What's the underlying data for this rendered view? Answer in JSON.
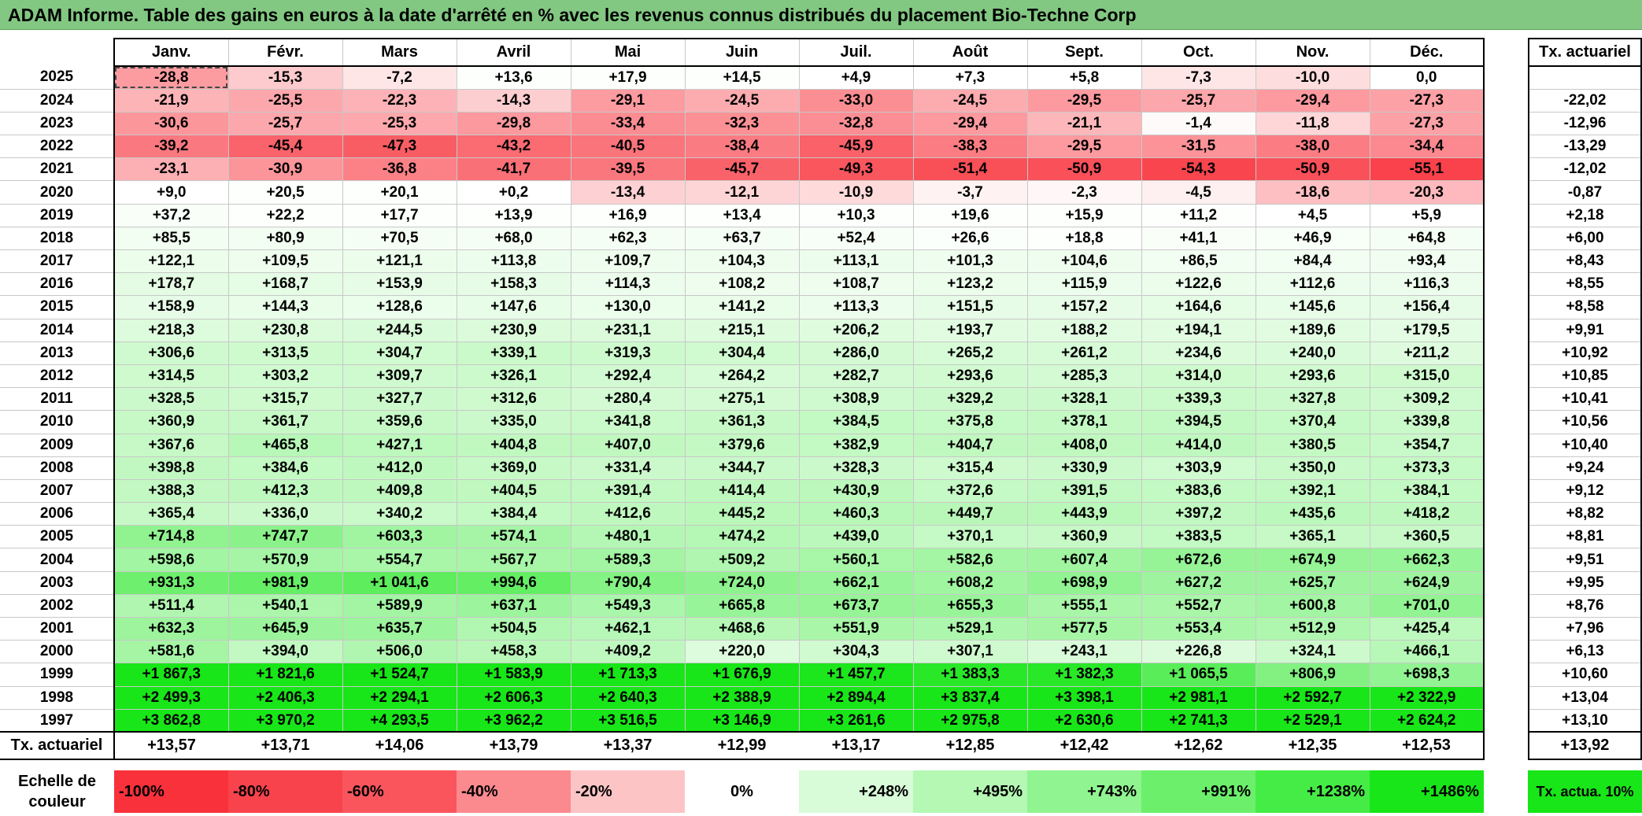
{
  "title": "ADAM Informe. Table des gains en euros à la date d'arrêté en % avec les revenus connus distribués du placement Bio-Techne Corp",
  "months": [
    "Janv.",
    "Févr.",
    "Mars",
    "Avril",
    "Mai",
    "Juin",
    "Juil.",
    "Août",
    "Sept.",
    "Oct.",
    "Nov.",
    "Déc."
  ],
  "tx_header": "Tx. actuariel",
  "rows": [
    {
      "year": "2025",
      "values": [
        "-28,8",
        "-15,3",
        "-7,2",
        "+13,6",
        "+17,9",
        "+14,5",
        "+4,9",
        "+7,3",
        "+5,8",
        "-7,3",
        "-10,0",
        "0,0"
      ],
      "tx": ""
    },
    {
      "year": "2024",
      "values": [
        "-21,9",
        "-25,5",
        "-22,3",
        "-14,3",
        "-29,1",
        "-24,5",
        "-33,0",
        "-24,5",
        "-29,5",
        "-25,7",
        "-29,4",
        "-27,3"
      ],
      "tx": "-22,02"
    },
    {
      "year": "2023",
      "values": [
        "-30,6",
        "-25,7",
        "-25,3",
        "-29,8",
        "-33,4",
        "-32,3",
        "-32,8",
        "-29,4",
        "-21,1",
        "-1,4",
        "-11,8",
        "-27,3"
      ],
      "tx": "-12,96"
    },
    {
      "year": "2022",
      "values": [
        "-39,2",
        "-45,4",
        "-47,3",
        "-43,2",
        "-40,5",
        "-38,4",
        "-45,9",
        "-38,3",
        "-29,5",
        "-31,5",
        "-38,0",
        "-34,4"
      ],
      "tx": "-13,29"
    },
    {
      "year": "2021",
      "values": [
        "-23,1",
        "-30,9",
        "-36,8",
        "-41,7",
        "-39,5",
        "-45,7",
        "-49,3",
        "-51,4",
        "-50,9",
        "-54,3",
        "-50,9",
        "-55,1"
      ],
      "tx": "-12,02"
    },
    {
      "year": "2020",
      "values": [
        "+9,0",
        "+20,5",
        "+20,1",
        "+0,2",
        "-13,4",
        "-12,1",
        "-10,9",
        "-3,7",
        "-2,3",
        "-4,5",
        "-18,6",
        "-20,3"
      ],
      "tx": "-0,87"
    },
    {
      "year": "2019",
      "values": [
        "+37,2",
        "+22,2",
        "+17,7",
        "+13,9",
        "+16,9",
        "+13,4",
        "+10,3",
        "+19,6",
        "+15,9",
        "+11,2",
        "+4,5",
        "+5,9"
      ],
      "tx": "+2,18"
    },
    {
      "year": "2018",
      "values": [
        "+85,5",
        "+80,9",
        "+70,5",
        "+68,0",
        "+62,3",
        "+63,7",
        "+52,4",
        "+26,6",
        "+18,8",
        "+41,1",
        "+46,9",
        "+64,8"
      ],
      "tx": "+6,00"
    },
    {
      "year": "2017",
      "values": [
        "+122,1",
        "+109,5",
        "+121,1",
        "+113,8",
        "+109,7",
        "+104,3",
        "+113,1",
        "+101,3",
        "+104,6",
        "+86,5",
        "+84,4",
        "+93,4"
      ],
      "tx": "+8,43"
    },
    {
      "year": "2016",
      "values": [
        "+178,7",
        "+168,7",
        "+153,9",
        "+158,3",
        "+114,3",
        "+108,2",
        "+108,7",
        "+123,2",
        "+115,9",
        "+122,6",
        "+112,6",
        "+116,3"
      ],
      "tx": "+8,55"
    },
    {
      "year": "2015",
      "values": [
        "+158,9",
        "+144,3",
        "+128,6",
        "+147,6",
        "+130,0",
        "+141,2",
        "+113,3",
        "+151,5",
        "+157,2",
        "+164,6",
        "+145,6",
        "+156,4"
      ],
      "tx": "+8,58"
    },
    {
      "year": "2014",
      "values": [
        "+218,3",
        "+230,8",
        "+244,5",
        "+230,9",
        "+231,1",
        "+215,1",
        "+206,2",
        "+193,7",
        "+188,2",
        "+194,1",
        "+189,6",
        "+179,5"
      ],
      "tx": "+9,91"
    },
    {
      "year": "2013",
      "values": [
        "+306,6",
        "+313,5",
        "+304,7",
        "+339,1",
        "+319,3",
        "+304,4",
        "+286,0",
        "+265,2",
        "+261,2",
        "+234,6",
        "+240,0",
        "+211,2"
      ],
      "tx": "+10,92"
    },
    {
      "year": "2012",
      "values": [
        "+314,5",
        "+303,2",
        "+309,7",
        "+326,1",
        "+292,4",
        "+264,2",
        "+282,7",
        "+293,6",
        "+285,3",
        "+314,0",
        "+293,6",
        "+315,0"
      ],
      "tx": "+10,85"
    },
    {
      "year": "2011",
      "values": [
        "+328,5",
        "+315,7",
        "+327,7",
        "+312,6",
        "+280,4",
        "+275,1",
        "+308,9",
        "+329,2",
        "+328,1",
        "+339,3",
        "+327,8",
        "+309,2"
      ],
      "tx": "+10,41"
    },
    {
      "year": "2010",
      "values": [
        "+360,9",
        "+361,7",
        "+359,6",
        "+335,0",
        "+341,8",
        "+361,3",
        "+384,5",
        "+375,8",
        "+378,1",
        "+394,5",
        "+370,4",
        "+339,8"
      ],
      "tx": "+10,56"
    },
    {
      "year": "2009",
      "values": [
        "+367,6",
        "+465,8",
        "+427,1",
        "+404,8",
        "+407,0",
        "+379,6",
        "+382,9",
        "+404,7",
        "+408,0",
        "+414,0",
        "+380,5",
        "+354,7"
      ],
      "tx": "+10,40"
    },
    {
      "year": "2008",
      "values": [
        "+398,8",
        "+384,6",
        "+412,0",
        "+369,0",
        "+331,4",
        "+344,7",
        "+328,3",
        "+315,4",
        "+330,9",
        "+303,9",
        "+350,0",
        "+373,3"
      ],
      "tx": "+9,24"
    },
    {
      "year": "2007",
      "values": [
        "+388,3",
        "+412,3",
        "+409,8",
        "+404,5",
        "+391,4",
        "+414,4",
        "+430,9",
        "+372,6",
        "+391,5",
        "+383,6",
        "+392,1",
        "+384,1"
      ],
      "tx": "+9,12"
    },
    {
      "year": "2006",
      "values": [
        "+365,4",
        "+336,0",
        "+340,2",
        "+384,4",
        "+412,6",
        "+445,2",
        "+460,3",
        "+449,7",
        "+443,9",
        "+397,2",
        "+435,6",
        "+418,2"
      ],
      "tx": "+8,82"
    },
    {
      "year": "2005",
      "values": [
        "+714,8",
        "+747,7",
        "+603,3",
        "+574,1",
        "+480,1",
        "+474,2",
        "+439,0",
        "+370,1",
        "+360,9",
        "+383,5",
        "+365,1",
        "+360,5"
      ],
      "tx": "+8,81"
    },
    {
      "year": "2004",
      "values": [
        "+598,6",
        "+570,9",
        "+554,7",
        "+567,7",
        "+589,3",
        "+509,2",
        "+560,1",
        "+582,6",
        "+607,4",
        "+672,6",
        "+674,9",
        "+662,3"
      ],
      "tx": "+9,51"
    },
    {
      "year": "2003",
      "values": [
        "+931,3",
        "+981,9",
        "+1 041,6",
        "+994,6",
        "+790,4",
        "+724,0",
        "+662,1",
        "+608,2",
        "+698,9",
        "+627,2",
        "+625,7",
        "+624,9"
      ],
      "tx": "+9,95"
    },
    {
      "year": "2002",
      "values": [
        "+511,4",
        "+540,1",
        "+589,9",
        "+637,1",
        "+549,3",
        "+665,8",
        "+673,7",
        "+655,3",
        "+555,1",
        "+552,7",
        "+600,8",
        "+701,0"
      ],
      "tx": "+8,76"
    },
    {
      "year": "2001",
      "values": [
        "+632,3",
        "+645,9",
        "+635,7",
        "+504,5",
        "+462,1",
        "+468,6",
        "+551,9",
        "+529,1",
        "+577,5",
        "+553,4",
        "+512,9",
        "+425,4"
      ],
      "tx": "+7,96"
    },
    {
      "year": "2000",
      "values": [
        "+581,6",
        "+394,0",
        "+506,0",
        "+458,3",
        "+409,2",
        "+220,0",
        "+304,3",
        "+307,1",
        "+243,1",
        "+226,8",
        "+324,1",
        "+466,1"
      ],
      "tx": "+6,13"
    },
    {
      "year": "1999",
      "values": [
        "+1 867,3",
        "+1 821,6",
        "+1 524,7",
        "+1 583,9",
        "+1 713,3",
        "+1 676,9",
        "+1 457,7",
        "+1 383,3",
        "+1 382,3",
        "+1 065,5",
        "+806,9",
        "+698,3"
      ],
      "tx": "+10,60"
    },
    {
      "year": "1998",
      "values": [
        "+2 499,3",
        "+2 406,3",
        "+2 294,1",
        "+2 606,3",
        "+2 640,3",
        "+2 388,9",
        "+2 894,4",
        "+3 837,4",
        "+3 398,1",
        "+2 981,1",
        "+2 592,7",
        "+2 322,9"
      ],
      "tx": "+13,04"
    },
    {
      "year": "1997",
      "values": [
        "+3 862,8",
        "+3 970,2",
        "+4 293,5",
        "+3 962,2",
        "+3 516,5",
        "+3 146,9",
        "+3 261,6",
        "+2 975,8",
        "+2 630,6",
        "+2 741,3",
        "+2 529,1",
        "+2 624,2"
      ],
      "tx": "+13,10"
    }
  ],
  "tx_row": {
    "label": "Tx. actuariel",
    "values": [
      "+13,57",
      "+13,71",
      "+14,06",
      "+13,79",
      "+13,37",
      "+12,99",
      "+13,17",
      "+12,85",
      "+12,42",
      "+12,62",
      "+12,35",
      "+12,53"
    ],
    "total": "+13,92"
  },
  "legend": {
    "label": "Echelle de couleur",
    "items": [
      {
        "text": "-100%",
        "color": "#f8313b",
        "align": "left"
      },
      {
        "text": "-80%",
        "color": "#f9434c",
        "align": "left"
      },
      {
        "text": "-60%",
        "color": "#fa555d",
        "align": "left"
      },
      {
        "text": "-40%",
        "color": "#fb8a8f",
        "align": "left"
      },
      {
        "text": "-20%",
        "color": "#fdc4c6",
        "align": "left"
      },
      {
        "text": "0%",
        "color": "#ffffff",
        "align": "center"
      },
      {
        "text": "+248%",
        "color": "#d8fcd8",
        "align": "right"
      },
      {
        "text": "+495%",
        "color": "#b4f8b4",
        "align": "right"
      },
      {
        "text": "+743%",
        "color": "#90f490",
        "align": "right"
      },
      {
        "text": "+991%",
        "color": "#6cf06c",
        "align": "right"
      },
      {
        "text": "+1238%",
        "color": "#46ec46",
        "align": "right"
      },
      {
        "text": "+1486%",
        "color": "#18e618",
        "align": "right"
      }
    ],
    "tx_label": "Tx. actua. 10%",
    "tx_color": "#18e618"
  },
  "selected_cell": {
    "year": "2025",
    "month": "Janv."
  }
}
